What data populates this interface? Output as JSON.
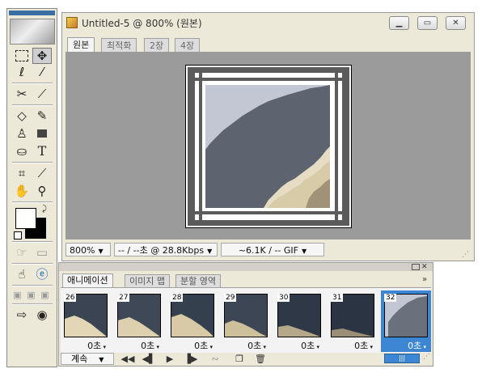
{
  "toolbox": {
    "tools": [
      "marquee-icon",
      "move-icon",
      "lasso-icon",
      "magic-wand-icon",
      "slice-icon",
      "slice-select-icon",
      "eraser-icon",
      "pencil-icon",
      "stamp-icon",
      "rectangle-icon",
      "paint-bucket-icon",
      "type-icon",
      "crop-icon",
      "eyedropper-icon",
      "hand-icon",
      "zoom-icon"
    ],
    "type_glyph": "T",
    "foreground": "#ffffff",
    "background": "#000000"
  },
  "document": {
    "title": "Untitled-5 @ 800% (원본)",
    "tabs": [
      "원본",
      "최적화",
      "2장",
      "4장"
    ],
    "active_tab": 0,
    "status": {
      "zoom": "800%",
      "download": "-- / --초 @ 28.8Kbps",
      "size": "~6.1K / -- GIF"
    },
    "colors": {
      "sky": "#c3c6d3",
      "dark": "#5e6370",
      "sand": "#e6dcc4"
    }
  },
  "animation": {
    "tabs": [
      "애니메이션",
      "이미지 맵",
      "분할 영역"
    ],
    "active_tab": 0,
    "frames": [
      {
        "num": "26",
        "delay": "0초"
      },
      {
        "num": "27",
        "delay": "0초"
      },
      {
        "num": "28",
        "delay": "0초"
      },
      {
        "num": "29",
        "delay": "0초"
      },
      {
        "num": "30",
        "delay": "0초"
      },
      {
        "num": "31",
        "delay": "0초"
      },
      {
        "num": "32",
        "delay": "0초"
      }
    ],
    "selected_frame": 6,
    "loop": "계속",
    "controls": [
      "◀◀",
      "◀▌",
      "▶",
      "▐▶"
    ]
  }
}
